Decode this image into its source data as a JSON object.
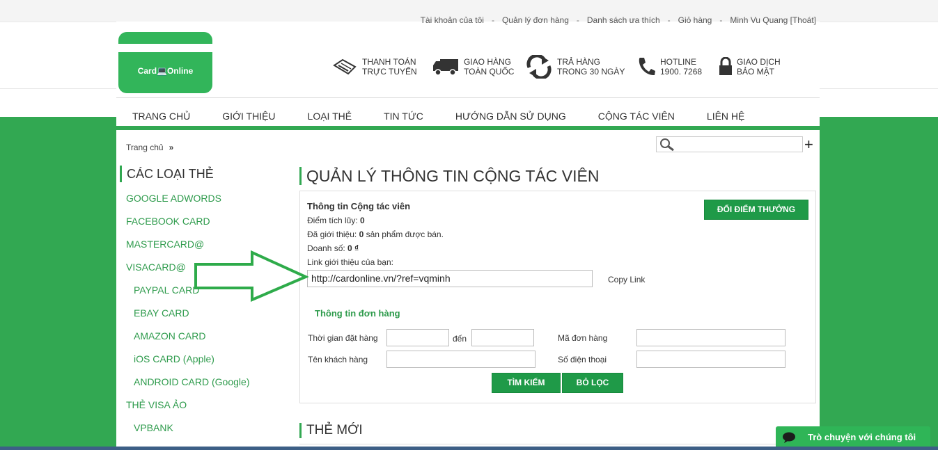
{
  "top_links": [
    "Tài khoản của tôi",
    "Quản lý đơn hàng",
    "Danh sách ưa thích",
    "Giỏ hàng",
    "Minh Vu Quang [Thoát]"
  ],
  "logo": {
    "text": "Card💻Online"
  },
  "features": [
    {
      "icon": "hand-card-icon",
      "line1": "THANH TOÁN",
      "line2": "TRỰC TUYẾN"
    },
    {
      "icon": "truck-icon",
      "line1": "GIAO HÀNG",
      "line2": "TOÀN QUỐC"
    },
    {
      "icon": "return-arrows-icon",
      "line1": "TRẢ HÀNG",
      "line2": "TRONG 30 NGÀY"
    },
    {
      "icon": "phone-icon",
      "line1": "HOTLINE",
      "line2": "1900. 7268"
    },
    {
      "icon": "lock-icon",
      "line1": "GIAO DỊCH",
      "line2": "BẢO MẬT"
    }
  ],
  "nav": [
    "TRANG CHỦ",
    "GIỚI THIỆU",
    "LOẠI THẺ",
    "TIN TỨC",
    "HƯỚNG DẪN SỬ DỤNG",
    "CỘNG TÁC VIÊN",
    "LIÊN HỆ"
  ],
  "breadcrumb": {
    "home": "Trang chủ",
    "sep": "»"
  },
  "sidebar": {
    "title": "CÁC LOẠI THẺ",
    "items": [
      "GOOGLE ADWORDS",
      "FACEBOOK CARD",
      "MASTERCARD@",
      "VISACARD@",
      "PAYPAL CARD",
      "EBAY CARD",
      "AMAZON CARD",
      "iOS CARD (Apple)",
      "ANDROID CARD (Google)",
      "THẺ VISA ẢO",
      "VPBANK"
    ]
  },
  "main": {
    "title": "QUẢN LÝ THÔNG TIN CỘNG TÁC VIÊN",
    "info_title": "Thông tin Cộng tác viên",
    "points_label": "Điểm tích lũy:",
    "points_value": "0",
    "referred_label": "Đã giới thiệu:",
    "referred_value": "0",
    "referred_suffix": "sản phẩm được bán.",
    "sales_label": "Doanh số:",
    "sales_value": "0 ₫",
    "ref_link_label": "Link giới thiệu của bạn:",
    "ref_link_value": "http://cardonline.vn/?ref=vqminh",
    "copy_link": "Copy Link",
    "redeem_button": "ĐỔI ĐIỂM THƯỞNG",
    "orders_title": "Thông tin đơn hàng",
    "order_time_label": "Thời gian đặt hàng",
    "to_label": "đến",
    "order_code_label": "Mã đơn hàng",
    "customer_label": "Tên khách hàng",
    "phone_label": "Số điện thoại",
    "search_button": "TÌM KIẾM",
    "clear_button": "BỎ LỌC",
    "new_title": "THẺ MỚI"
  },
  "chat": {
    "label": "Trò chuyện với chúng tôi"
  },
  "colors": {
    "brand_green": "#32a852",
    "button_green": "#1f9a48",
    "link_green": "#2e9b4c"
  }
}
